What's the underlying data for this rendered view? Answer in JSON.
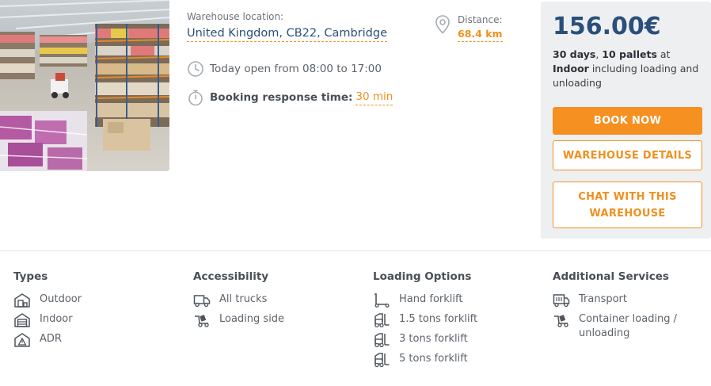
{
  "listing": {
    "photo_alt": "warehouse-interior-photo",
    "location_label": "Warehouse location:",
    "location_value": "United Kingdom, CB22, Cambridge",
    "hours": "Today open from 08:00 to 17:00",
    "booking_label": "Booking response time:",
    "booking_value": "30 min",
    "distance_label": "Distance:",
    "distance_value": "68.4 km"
  },
  "pricing": {
    "price": "156.00€",
    "days": "30 days",
    "pallets": "10 pallets",
    "at": "at",
    "storage_type": "Indoor",
    "note": "including loading and unloading",
    "book_label": "BOOK NOW",
    "details_label": "WAREHOUSE DETAILS",
    "chat_label": "CHAT WITH THIS WAREHOUSE"
  },
  "features": {
    "types": {
      "title": "Types",
      "items": [
        "Outdoor",
        "Indoor",
        "ADR"
      ]
    },
    "accessibility": {
      "title": "Accessibility",
      "items": [
        "All trucks",
        "Loading side"
      ]
    },
    "loading": {
      "title": "Loading Options",
      "items": [
        "Hand forklift",
        "1.5 tons forklift",
        "3 tons forklift",
        "5 tons forklift"
      ]
    },
    "services": {
      "title": "Additional Services",
      "items": [
        "Transport",
        "Container loading / unloading"
      ]
    }
  },
  "colors": {
    "accent": "#f59021",
    "price": "#2a4f7a",
    "panel": "#eeeff1"
  }
}
